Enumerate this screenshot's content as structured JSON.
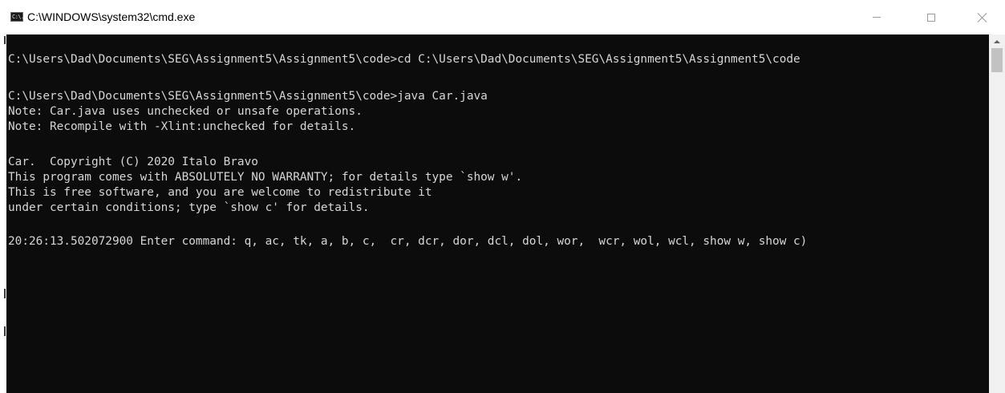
{
  "window": {
    "title": "C:\\WINDOWS\\system32\\cmd.exe",
    "icon_label": "C:\\."
  },
  "console": {
    "lines": [
      "C:\\Users\\Dad\\Documents\\SEG\\Assignment5\\Assignment5\\code>cd C:\\Users\\Dad\\Documents\\SEG\\Assignment5\\Assignment5\\code",
      "",
      "C:\\Users\\Dad\\Documents\\SEG\\Assignment5\\Assignment5\\code>java Car.java",
      "Note: Car.java uses unchecked or unsafe operations.",
      "Note: Recompile with -Xlint:unchecked for details.",
      "",
      "Car.  Copyright (C) 2020 Italo Bravo",
      "This program comes with ABSOLUTELY NO WARRANTY; for details type `show w'.",
      "This is free software, and you are welcome to redistribute it",
      "under certain conditions; type `show c' for details.",
      "",
      "20:26:13.502072900 Enter command: q, ac, tk, a, b, c,  cr, dcr, dor, dcl, dol, wor,  wcr, wol, wcl, show w, show c)"
    ]
  },
  "colors": {
    "console_bg": "#0c0c0c",
    "console_text": "#d6d6d6",
    "titlebar_bg": "#ffffff",
    "scrollbar_bg": "#f0f0f0"
  }
}
